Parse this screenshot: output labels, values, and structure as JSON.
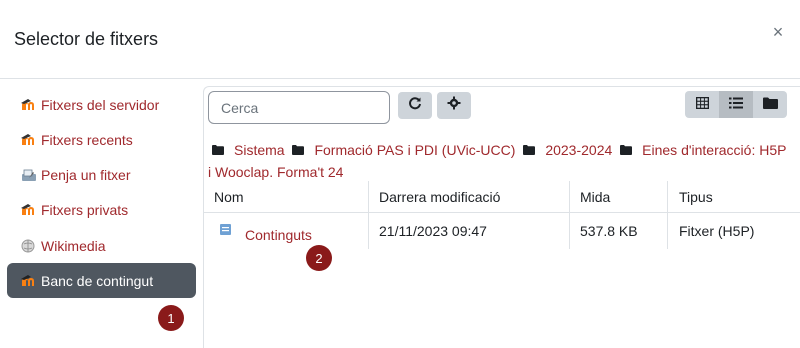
{
  "dialog": {
    "title": "Selector de fitxers",
    "close_glyph": "×"
  },
  "sidebar": {
    "items": [
      {
        "label": "Fitxers del servidor",
        "icon": "moodle-icon"
      },
      {
        "label": "Fitxers recents",
        "icon": "moodle-icon"
      },
      {
        "label": "Penja un fitxer",
        "icon": "upload-icon"
      },
      {
        "label": "Fitxers privats",
        "icon": "moodle-icon"
      },
      {
        "label": "Wikimedia",
        "icon": "wikimedia-icon"
      },
      {
        "label": "Banc de contingut",
        "icon": "moodle-icon",
        "active": true
      }
    ]
  },
  "toolbar": {
    "search_placeholder": "Cerca",
    "refresh_icon": "refresh-icon",
    "settings_icon": "gear-icon",
    "view_icons": [
      "grid-view-icon",
      "list-view-icon",
      "folder-view-icon"
    ],
    "active_view": "list-view-icon"
  },
  "breadcrumb": [
    "Sistema",
    "Formació PAS i PDI (UVic-UCC)",
    "2023-2024",
    "Eines d'interacció: H5P i Wooclap. Forma't 24"
  ],
  "table": {
    "columns": [
      "Nom",
      "Darrera modificació",
      "Mida",
      "Tipus"
    ],
    "rows": [
      {
        "name": "Continguts",
        "modified": "21/11/2023 09:47",
        "size": "537.8 KB",
        "type": "Fitxer (H5P)"
      }
    ]
  },
  "badges": [
    "1",
    "2"
  ],
  "colors": {
    "link": "#a0292d",
    "active_bg": "#4f5760",
    "badge": "#8a1a1a",
    "button_bg": "#ced4da"
  }
}
